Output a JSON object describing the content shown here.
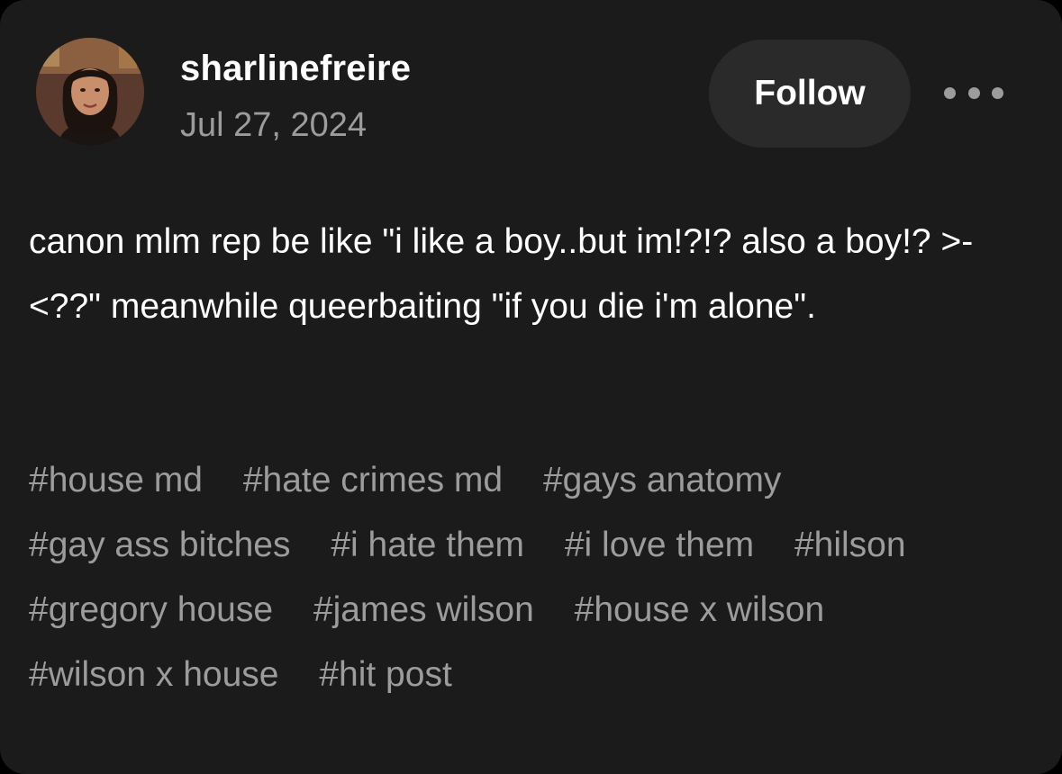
{
  "post": {
    "username": "sharlinefreire",
    "date": "Jul 27, 2024",
    "follow_label": "Follow",
    "more_icon": "more-horizontal-icon",
    "body": "canon mlm rep be like \"i like a boy..but im!?!? also a boy!? >-<??\" meanwhile queerbaiting \"if you die i'm alone\".",
    "tags": [
      "#house md",
      "#hate crimes md",
      "#gays anatomy",
      "#gay ass bitches",
      "#i hate them",
      "#i love them",
      "#hilson",
      "#gregory house",
      "#james wilson",
      "#house x wilson",
      "#wilson x house",
      "#hit post"
    ]
  },
  "colors": {
    "background": "#1b1b1b",
    "text": "#ffffff",
    "muted_text": "#9c9c9c",
    "button_bg": "#2a2a2a"
  }
}
